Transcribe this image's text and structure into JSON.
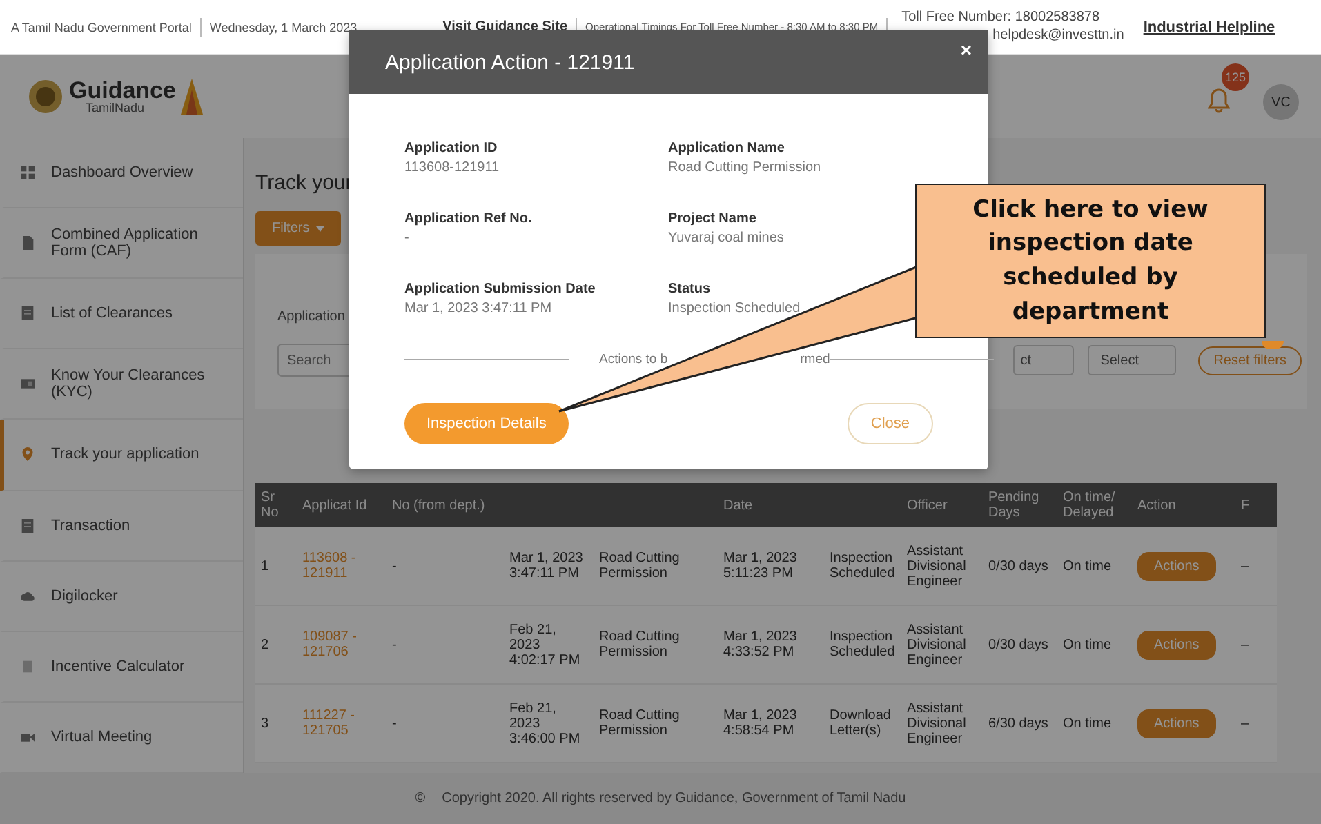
{
  "top_bar": {
    "portal": "A Tamil Nadu Government Portal",
    "date": "Wednesday, 1 March 2023",
    "link": "Visit Guidance Site",
    "timings": "Operational Timings For Toll Free Number - 8:30 AM to 8:30 PM",
    "toll_free": "Toll Free Number: 18002583878",
    "email": "helpdesk@investtn.in",
    "helpline": "Industrial Helpline"
  },
  "header": {
    "logo_title": "Guidance",
    "logo_subtitle": "TamilNadu",
    "notification_count": "125",
    "avatar": "VC"
  },
  "sidebar": {
    "items": [
      {
        "label": "Dashboard Overview",
        "selected": false
      },
      {
        "label": "Combined Application Form (CAF)",
        "selected": false
      },
      {
        "label": "List of Clearances",
        "selected": false
      },
      {
        "label": "Know Your Clearances (KYC)",
        "selected": false
      },
      {
        "label": "Track your application",
        "selected": true
      },
      {
        "label": "Transaction",
        "selected": false
      },
      {
        "label": "Digilocker",
        "selected": false
      },
      {
        "label": "Incentive Calculator",
        "selected": false
      },
      {
        "label": "Virtual Meeting",
        "selected": false
      }
    ]
  },
  "main": {
    "title": "Track your",
    "filters_button": "Filters",
    "filter_label": "Application",
    "search": {
      "placeholder": "Search"
    },
    "select_1": "ct",
    "select_2": "Select",
    "reset_button": "Reset filters"
  },
  "table": {
    "columns": [
      {
        "label": "Sr No"
      },
      {
        "label": "Applicat Id"
      },
      {
        "label": "No (from dept.)"
      },
      {},
      {},
      {
        "label": "Date"
      },
      {},
      {
        "label": "Officer"
      },
      {
        "label": "Pending Days"
      },
      {
        "label": "On time/ Delayed"
      },
      {
        "label": "Action"
      },
      {
        "label": "F"
      }
    ],
    "rows": [
      {
        "cells": [
          "1",
          "113608 - 121911",
          "-",
          "Mar 1, 2023 3:47:11 PM",
          "Road Cutting Permission",
          "Mar 1, 2023 5:11:23 PM",
          "Inspection Scheduled",
          "Assistant Divisional Engineer",
          "0/30 days",
          "On time",
          "Actions",
          "–"
        ]
      },
      {
        "cells": [
          "2",
          "109087 - 121706",
          "-",
          "Feb 21, 2023 4:02:17 PM",
          "Road Cutting Permission",
          "Mar 1, 2023 4:33:52 PM",
          "Inspection Scheduled",
          "Assistant Divisional Engineer",
          "0/30 days",
          "On time",
          "Actions",
          "–"
        ]
      },
      {
        "cells": [
          "3",
          "111227 - 121705",
          "-",
          "Feb 21, 2023 3:46:00 PM",
          "Road Cutting Permission",
          "Mar 1, 2023 4:58:54 PM",
          "Download Letter(s)",
          "Assistant Divisional Engineer",
          "6/30 days",
          "On time",
          "Actions",
          "–"
        ]
      }
    ]
  },
  "footer": {
    "copyright_mark": "©",
    "text": "Copyright 2020. All rights reserved by Guidance, Government of Tamil Nadu"
  },
  "modal": {
    "title": "Application Action - 121911",
    "close_icon": "×",
    "fields": [
      {
        "label": "Application ID",
        "value": "113608-121911"
      },
      {
        "label": "Application Name",
        "value": "Road Cutting Permission"
      },
      {
        "label": "Application Ref No.",
        "value": "-"
      },
      {
        "label": "Project Name",
        "value": "Yuvaraj coal mines"
      },
      {
        "label": "Application Submission Date",
        "value": "Mar 1, 2023 3:47:11 PM"
      },
      {
        "label": "Status",
        "value": "Inspection Scheduled"
      }
    ],
    "divider_text_start": "Actions to b",
    "divider_text_end": "rmed",
    "primary_button": "Inspection Details",
    "close_button": "Close"
  },
  "callout": {
    "text": "Click here to view inspection date scheduled by department"
  }
}
